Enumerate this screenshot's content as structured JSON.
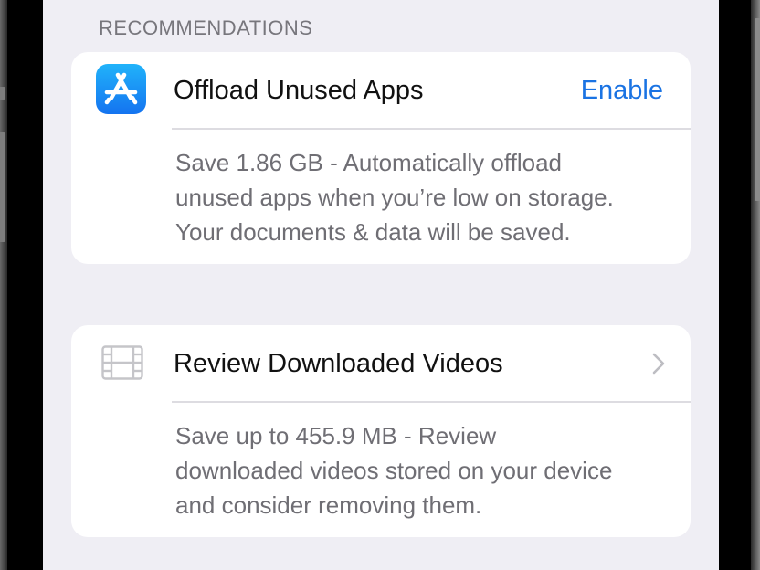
{
  "recommendations": {
    "header": "RECOMMENDATIONS",
    "items": [
      {
        "icon": "app-store-icon",
        "title": "Offload Unused Apps",
        "action_label": "Enable",
        "description": "Save 1.86 GB - Automatically offload\nunused apps when you’re low on storage.\nYour documents & data will be saved."
      },
      {
        "icon": "film-icon",
        "title": "Review Downloaded Videos",
        "action_icon": "chevron-right-icon",
        "description": "Save up to 455.9 MB - Review\ndownloaded videos stored on your device\nand consider removing them."
      }
    ]
  },
  "colors": {
    "background": "#efeef4",
    "card": "#ffffff",
    "accent": "#1a73e3",
    "secondary_text": "#6f6e74"
  }
}
